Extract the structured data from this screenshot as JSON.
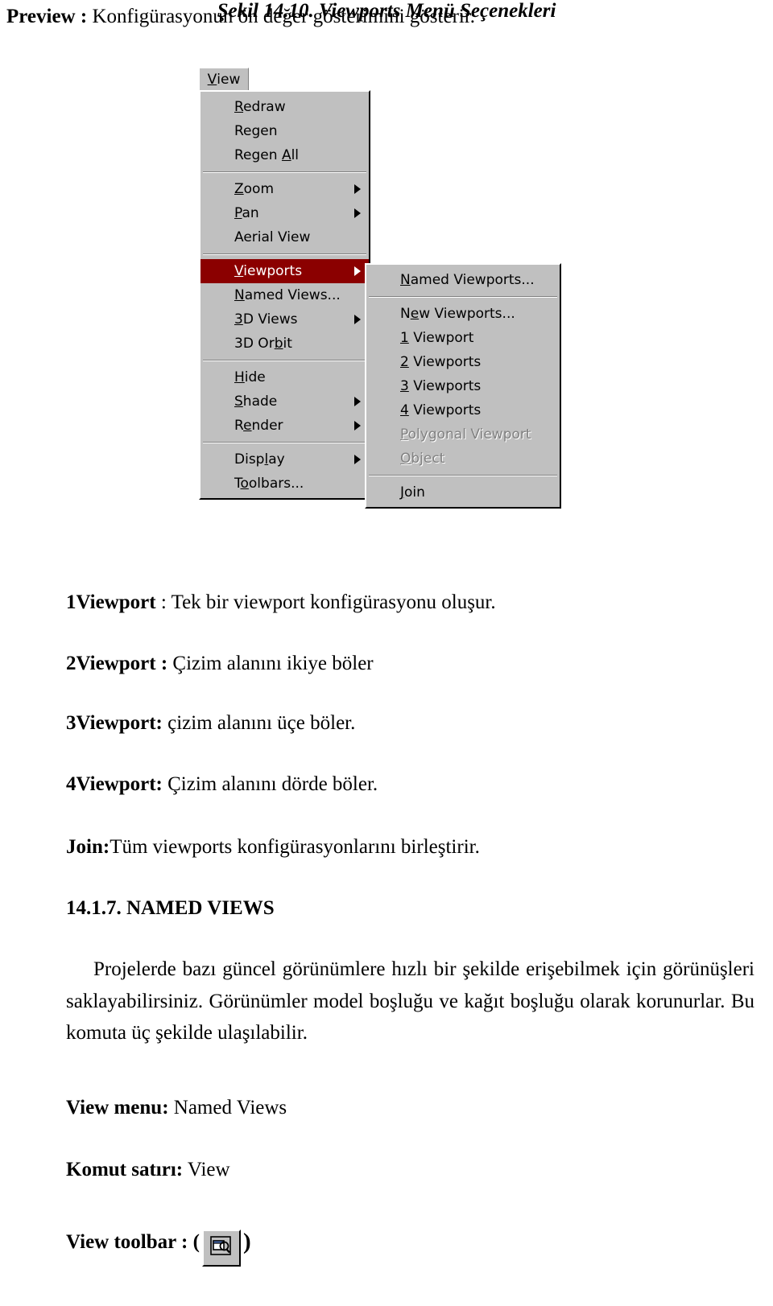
{
  "page": {
    "intro": {
      "lead": "Preview :",
      "rest": " Konfigürasyonun ön değer gösterimini gösterir."
    },
    "figure_caption": "Şekil 14.10. Viewports Menü Seçenekleri",
    "definitions": [
      {
        "term": "1Viewport",
        "sep": " : ",
        "desc": "Tek bir viewport konfigürasyonu oluşur."
      },
      {
        "term": "2Viewport",
        "sep": " : ",
        "desc": "Çizim alanını ikiye böler"
      },
      {
        "term": "3Viewport:",
        "sep": " ",
        "desc": "çizim alanını üçe böler."
      },
      {
        "term": "4Viewport:",
        "sep": " ",
        "desc": "Çizim alanını dörde böler."
      },
      {
        "term": "Join:",
        "sep": "",
        "desc": "Tüm viewports konfigürasyonlarını birleştirir."
      }
    ],
    "section_heading": "14.1.7. NAMED VIEWS",
    "body_paragraph": "Projelerde bazı güncel görünümlere hızlı bir şekilde erişebilmek için görünüşleri saklayabilirsiniz. Görünümler model boşluğu ve kağıt boşluğu olarak korunurlar. Bu komuta üç şekilde ulaşılabilir.",
    "access_methods": [
      {
        "label": "View menu:",
        "value": " Named Views"
      },
      {
        "label": "Komut satırı:",
        "value": " View"
      }
    ],
    "toolbar_line": {
      "label": "View toolbar : (",
      "close_paren": ")",
      "icon": "named-views-toolbar-icon"
    }
  },
  "figure": {
    "menubar": {
      "title_prefix": "V",
      "title_rest": "iew"
    },
    "view_menu": {
      "items": [
        {
          "hotkey": "R",
          "rest": "edraw",
          "type": "item"
        },
        {
          "hotkey": "",
          "rest": "Regen",
          "type": "item"
        },
        {
          "hotkey": "",
          "rest": "Regen A",
          "hotkey2": "A",
          "label_full": "Regen All",
          "type": "item"
        },
        {
          "type": "separator"
        },
        {
          "hotkey": "Z",
          "rest": "oom",
          "type": "item",
          "submenu": true
        },
        {
          "hotkey": "P",
          "rest": "an",
          "type": "item",
          "submenu": true
        },
        {
          "hotkey": "",
          "rest": "Aerial View",
          "type": "item"
        },
        {
          "type": "separator"
        },
        {
          "hotkey": "V",
          "rest": "iewports",
          "type": "item",
          "submenu": true,
          "selected": true
        },
        {
          "hotkey": "N",
          "rest": "amed Views...",
          "type": "item"
        },
        {
          "hotkey": "3",
          "rest": "D Views",
          "type": "item",
          "submenu": true
        },
        {
          "hotkey": "",
          "rest": "3D Orbit",
          "type": "item"
        },
        {
          "type": "separator"
        },
        {
          "hotkey": "H",
          "rest": "ide",
          "type": "item"
        },
        {
          "hotkey": "S",
          "rest": "hade",
          "type": "item",
          "submenu": true
        },
        {
          "hotkey": "R",
          "rest": "ender",
          "type": "item",
          "submenu": true
        },
        {
          "type": "separator"
        },
        {
          "hotkey": "D",
          "rest": "isplay",
          "type": "item",
          "submenu": true
        },
        {
          "hotkey": "T",
          "rest": "oolbars...",
          "type": "item"
        }
      ],
      "labels": [
        "Redraw",
        "Regen",
        "Regen All",
        "",
        "Zoom",
        "Pan",
        "Aerial View",
        "",
        "Viewports",
        "Named Views...",
        "3D Views",
        "3D Orbit",
        "",
        "Hide",
        "Shade",
        "Render",
        "",
        "Display",
        "Toolbars..."
      ]
    },
    "viewports_submenu": {
      "items": [
        {
          "label": "Named Viewports...",
          "disabled": false
        },
        {
          "separator": true
        },
        {
          "label": "New Viewports...",
          "disabled": false
        },
        {
          "label": "1 Viewport",
          "disabled": false
        },
        {
          "label": "2 Viewports",
          "disabled": false
        },
        {
          "label": "3 Viewports",
          "disabled": false
        },
        {
          "label": "4 Viewports",
          "disabled": false
        },
        {
          "label": "Polygonal Viewport",
          "disabled": true
        },
        {
          "label": "Object",
          "disabled": true
        },
        {
          "separator": true
        },
        {
          "label": "Join",
          "disabled": false
        }
      ]
    },
    "colors": {
      "menu_face": "#c0c0c0",
      "highlight": "#8b0000",
      "highlight_text": "#ffffff",
      "disabled_text": "#808080",
      "text": "#000000"
    }
  }
}
